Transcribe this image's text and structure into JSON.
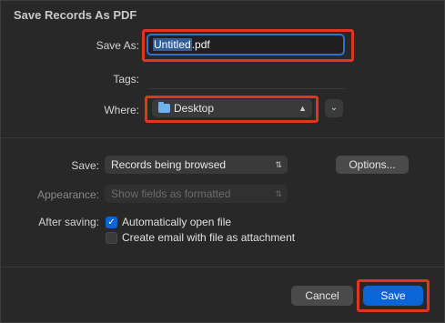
{
  "dialog": {
    "title": "Save Records As PDF"
  },
  "save_as": {
    "label": "Save As:",
    "filename_selected": "Untitled",
    "filename_ext": ".pdf"
  },
  "tags": {
    "label": "Tags:",
    "value": ""
  },
  "where": {
    "label": "Where:",
    "value": "Desktop",
    "icon": "folder-icon"
  },
  "save_option": {
    "label": "Save:",
    "value": "Records being browsed"
  },
  "options_button": {
    "label": "Options..."
  },
  "appearance": {
    "label": "Appearance:",
    "value": "Show fields as formatted",
    "enabled": false
  },
  "after_saving": {
    "label": "After saving:",
    "open_file": {
      "label": "Automatically open file",
      "checked": true
    },
    "create_email": {
      "label": "Create email with file as attachment",
      "checked": false
    }
  },
  "buttons": {
    "cancel": "Cancel",
    "save": "Save"
  },
  "colors": {
    "accent": "#0a66d6",
    "highlight": "#e0361e",
    "background": "#282828"
  }
}
